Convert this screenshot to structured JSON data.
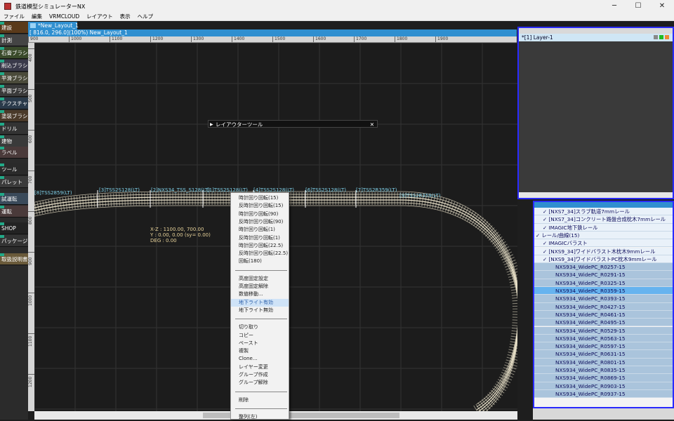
{
  "window": {
    "title": "鉄道模型シミュレーターNX",
    "controls": [
      "─",
      "☐",
      "✕"
    ]
  },
  "menu": [
    "ファイル",
    "編集",
    "VRMCLOUD",
    "レイアウト",
    "表示",
    "ヘルプ"
  ],
  "sidebar": [
    "建設",
    "計測",
    "石膏ブラシ",
    "削込ブラシ",
    "平滑ブラシ",
    "平面ブラシ",
    "テクスチャ",
    "塗装ブラシ",
    "ドリル",
    "建物",
    "ラベル",
    "ツール",
    "パレット",
    "試運転",
    "運転",
    "SHOP",
    "パッケージ",
    "取扱説明書"
  ],
  "document": {
    "tab": "*New_Layout_1",
    "coords": "[  816.0,   296.0](100%) New_Layout_1"
  },
  "ruler": {
    "h": [
      "900",
      "1000",
      "1100",
      "1200",
      "1300",
      "1400",
      "1500",
      "1600",
      "1700",
      "1800",
      "1900"
    ],
    "v": [
      "400",
      "500",
      "600",
      "700",
      "800",
      "900",
      "1000",
      "1100",
      "1200"
    ]
  },
  "tool_window": {
    "title": "レイアウターツール",
    "close": "✕",
    "arrow": "▶"
  },
  "overlay": {
    "xz": "X-Z :  1100.00,   700.00",
    "y": "Y  :    0.00,     0.00  (sy=    0.00)",
    "deg": "DEG :  0.00"
  },
  "track_labels": [
    "[8]TSS2859(LT)",
    "[3]TSS2S128(LT)",
    "[2]NXS34_TSS_S128(LT)",
    "[1]TSS2S128(LT)",
    "[4]TSS2S128(LT)",
    "[5]TSS2S128(LT)",
    "[6]TSS2S128(LT)",
    "[7]TSS2R359(LT)",
    "[9]TSS2R359(LT)"
  ],
  "context_menu": {
    "items_group1": [
      "時計回り回転(15)",
      "反時計回り回転(15)",
      "時計回り回転(90)",
      "反時計回り回転(90)",
      "時計回り回転(1)",
      "反時計回り回転(1)",
      "時計回り回転(22.5)",
      "反時計回り回転(22.5)",
      "回転(180)"
    ],
    "items_group2": [
      "高度固定設定",
      "高度固定解除",
      "数値移動...",
      "地下ライト有効",
      "地下ライト無効"
    ],
    "items_group3": [
      "切り取り",
      "コピー",
      "ペースト",
      "複製",
      "Clone...",
      "レイヤー変更",
      "グループ作成",
      "グループ解除"
    ],
    "items_group4": [
      "削除"
    ],
    "items_group5": [
      "整列(左)"
    ],
    "highlighted": "地下ライト有効"
  },
  "layer_panel": {
    "row": "*[1] Layer-1"
  },
  "parts_tree": {
    "groups_top": [
      "[NXS7_34]スラブ軌道7mmレール",
      "[NXS7_34]コンクリート路盤合成枕木7mmレール",
      "IMAGIC地下鉄レール"
    ],
    "category": "レール/曲線(15)",
    "groups_mid": [
      "IMAGICバラスト",
      "[NXS9_34]ワイドバラスト木枕木9mmレール",
      "[NXS9_34]ワイドバラストPC枕木9mmレール"
    ],
    "items": [
      "NXS934_WidePC_R0257-15",
      "NXS934_WidePC_R0291-15",
      "NXS934_WidePC_R0325-15",
      "NXS934_WidePC_R0359-15",
      "NXS934_WidePC_R0393-15",
      "NXS934_WidePC_R0427-15",
      "NXS934_WidePC_R0461-15",
      "NXS934_WidePC_R0495-15",
      "NXS934_WidePC_R0529-15",
      "NXS934_WidePC_R0563-15",
      "NXS934_WidePC_R0597-15",
      "NXS934_WidePC_R0631-15",
      "NXS934_WidePC_R0801-15",
      "NXS934_WidePC_R0835-15",
      "NXS934_WidePC_R0869-15",
      "NXS934_WidePC_R0903-15",
      "NXS934_WidePC_R0937-15"
    ],
    "selected": "NXS934_WidePC_R0359-15"
  },
  "colors": {
    "accent": "#2f8fd0",
    "panel_border": "#2a2aff",
    "track": "#e8e0c8",
    "label": "#7fd0e8"
  }
}
